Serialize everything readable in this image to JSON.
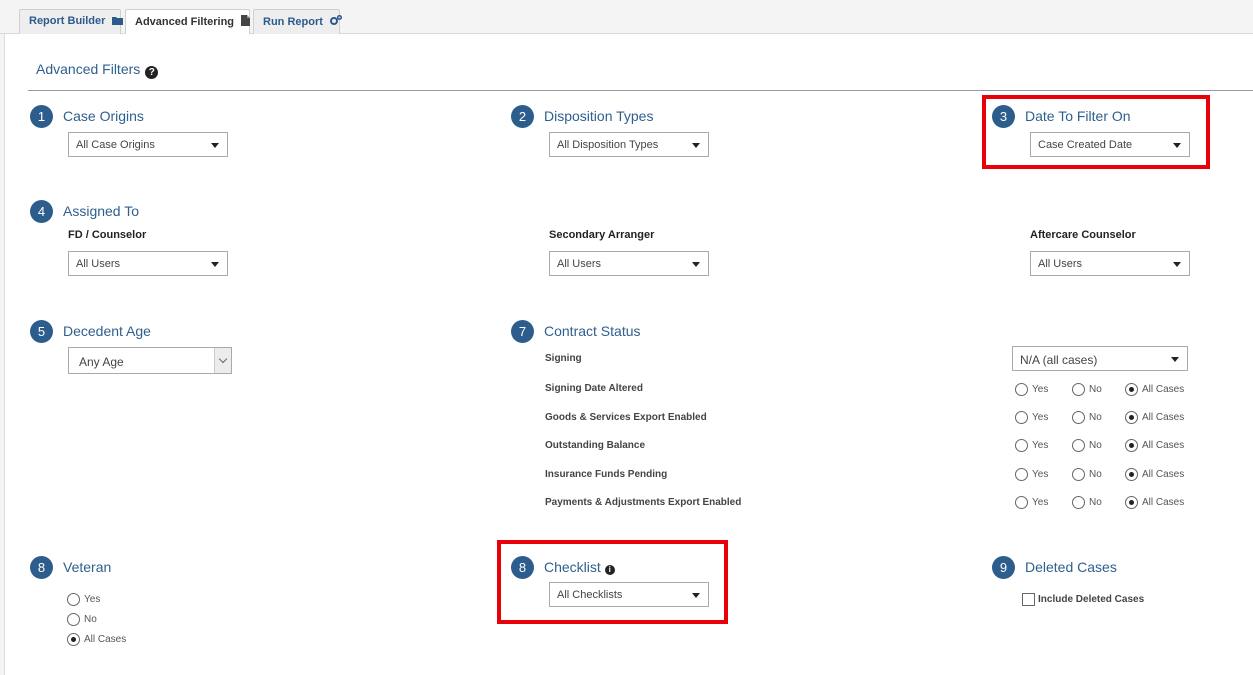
{
  "tabs": [
    {
      "label": "Report Builder",
      "icon": "folder-icon",
      "active": false
    },
    {
      "label": "Advanced Filtering",
      "icon": "document-icon",
      "active": true
    },
    {
      "label": "Run Report",
      "icon": "gears-icon",
      "active": false
    }
  ],
  "page": {
    "title": "Advanced Filters",
    "help_icon": "?"
  },
  "sections": {
    "case_origins": {
      "number": "1",
      "title": "Case Origins",
      "value": "All Case Origins"
    },
    "disposition_types": {
      "number": "2",
      "title": "Disposition Types",
      "value": "All Disposition Types"
    },
    "date_filter": {
      "number": "3",
      "title": "Date To Filter On",
      "value": "Case Created Date"
    },
    "assigned_to": {
      "number": "4",
      "title": "Assigned To",
      "fd_label": "FD / Counselor",
      "fd_value": "All Users",
      "secondary_label": "Secondary Arranger",
      "secondary_value": "All Users",
      "aftercare_label": "Aftercare Counselor",
      "aftercare_value": "All Users"
    },
    "decedent_age": {
      "number": "5",
      "title": "Decedent Age",
      "value": "Any Age"
    },
    "contract_status": {
      "number": "7",
      "title": "Contract Status",
      "signing_label": "Signing",
      "signing_value": "N/A (all cases)",
      "rows": [
        {
          "label": "Signing Date Altered"
        },
        {
          "label": "Goods & Services Export Enabled"
        },
        {
          "label": "Outstanding Balance"
        },
        {
          "label": "Insurance Funds Pending"
        },
        {
          "label": "Payments & Adjustments Export Enabled"
        }
      ],
      "options": {
        "yes": "Yes",
        "no": "No",
        "all": "All Cases"
      }
    },
    "veteran": {
      "number": "8",
      "title": "Veteran",
      "options": [
        "Yes",
        "No",
        "All Cases"
      ],
      "selected": "All Cases"
    },
    "checklist": {
      "number": "8",
      "title": "Checklist",
      "value": "All Checklists"
    },
    "deleted_cases": {
      "number": "9",
      "title": "Deleted Cases",
      "checkbox_label": "Include Deleted Cases"
    }
  },
  "colors": {
    "accent": "#2d5d8d",
    "highlight": "#e8000b"
  }
}
